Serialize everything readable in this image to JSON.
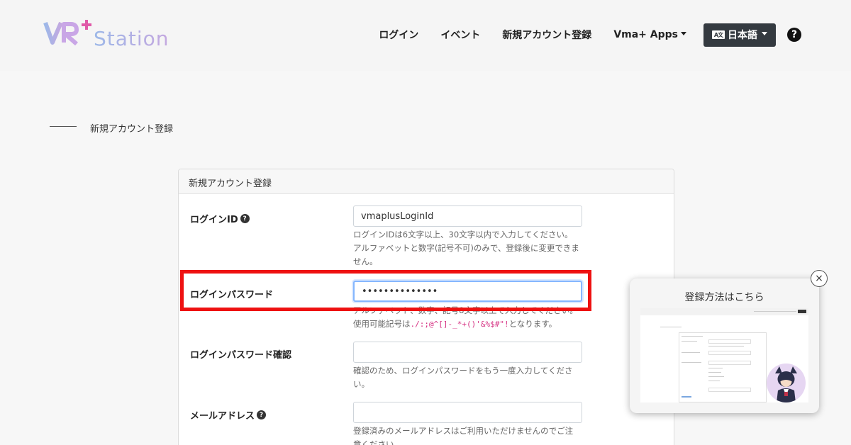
{
  "header": {
    "logo_text": "VR+ Station",
    "nav": {
      "login": "ログイン",
      "event": "イベント",
      "register": "新規アカウント登録",
      "apps": "Vma+ Apps",
      "lang_icon": "A文",
      "language": "日本語"
    },
    "help": "?"
  },
  "breadcrumb": {
    "title": "新規アカウント登録"
  },
  "form": {
    "title": "新規アカウント登録",
    "login_id": {
      "label": "ログインID",
      "value": "vmaplusLoginId",
      "help1": "ログインIDは6文字以上、30文字以内で入力してください。",
      "help2": "アルファベットと数字(記号不可)のみで、登録後に変更できま",
      "help3": "せん。"
    },
    "password": {
      "label": "ログインパスワード",
      "value": "••••••••••••••",
      "help1": "アルファベット、数字、記号8文字以上で入力してください。",
      "help2_prefix": "使用可能記号は",
      "help2_symbols": "./:;@^[]-_*+()'&%$#\"!",
      "help2_suffix": "となります。"
    },
    "password_confirm": {
      "label": "ログインパスワード確認",
      "value": "",
      "help1": "確認のため、ログインパスワードをもう一度入力してくださ",
      "help2": "い。"
    },
    "email": {
      "label": "メールアドレス",
      "value": "",
      "help1": "登録済みのメールアドレスはご利用いただけませんのでご注",
      "help2": "意ください。"
    }
  },
  "popup": {
    "title": "登録方法はこちら",
    "close": "×"
  },
  "colors": {
    "highlight": "#ee1111",
    "dark_button": "#343a40",
    "code": "#d63384"
  }
}
